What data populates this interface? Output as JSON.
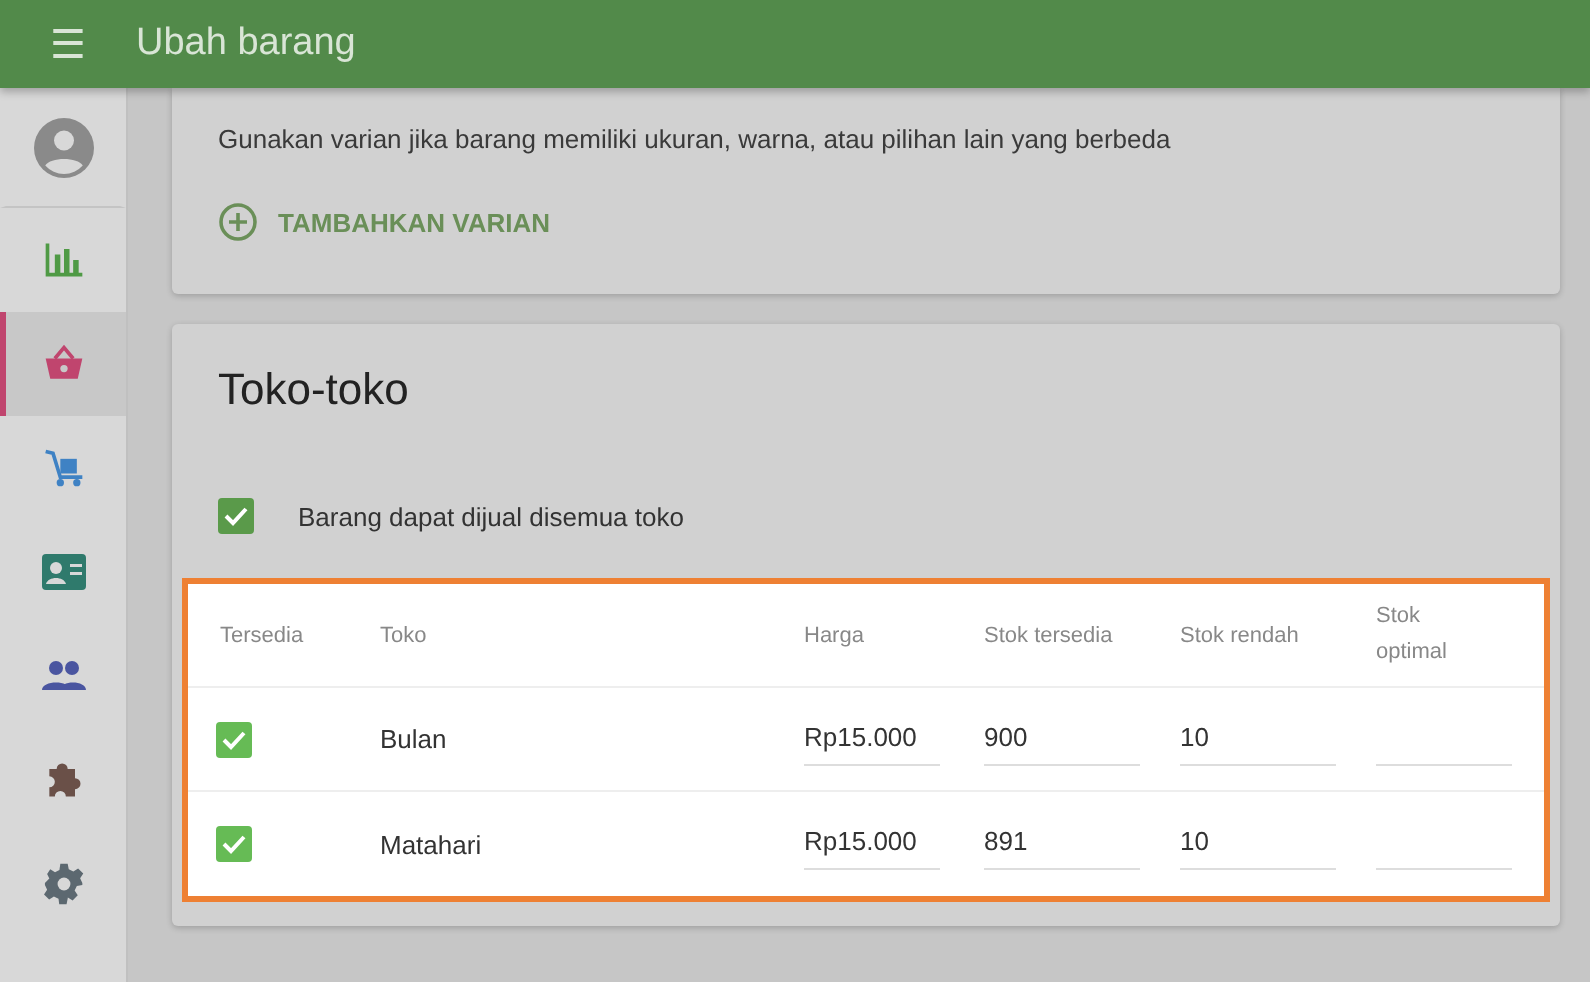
{
  "app_bar": {
    "menu_icon": "☰",
    "title": "Ubah barang"
  },
  "sidebar": {
    "items": [
      {
        "selected": false,
        "color": "#8a8a8a"
      },
      {
        "selected": false,
        "color": "#4f9a45"
      },
      {
        "selected": true,
        "color": "#c0456e"
      },
      {
        "selected": false,
        "color": "#3f82c4"
      },
      {
        "selected": false,
        "color": "#2f7a6c"
      },
      {
        "selected": false,
        "color": "#4a55a0"
      },
      {
        "selected": false,
        "color": "#6a5048"
      },
      {
        "selected": false,
        "color": "#5c6870"
      }
    ]
  },
  "variants_card": {
    "description": "Gunakan varian jika barang memiliki ukuran, warna, atau pilihan lain yang berbeda",
    "add_button": "TAMBAHKAN VARIAN"
  },
  "stores_card": {
    "title": "Toko-toko",
    "all_stores": {
      "label": "Barang dapat dijual disemua toko",
      "checked": true
    },
    "table": {
      "columns": [
        "Tersedia",
        "Toko",
        "Harga",
        "Stok tersedia",
        "Stok rendah",
        "Stok optimal"
      ],
      "rows": [
        {
          "available": true,
          "store": "Bulan",
          "price": "Rp15.000",
          "stock": "900",
          "low_stock": "10"
        },
        {
          "available": true,
          "store": "Matahari",
          "price": "Rp15.000",
          "stock": "891",
          "low_stock": "10"
        }
      ]
    }
  }
}
